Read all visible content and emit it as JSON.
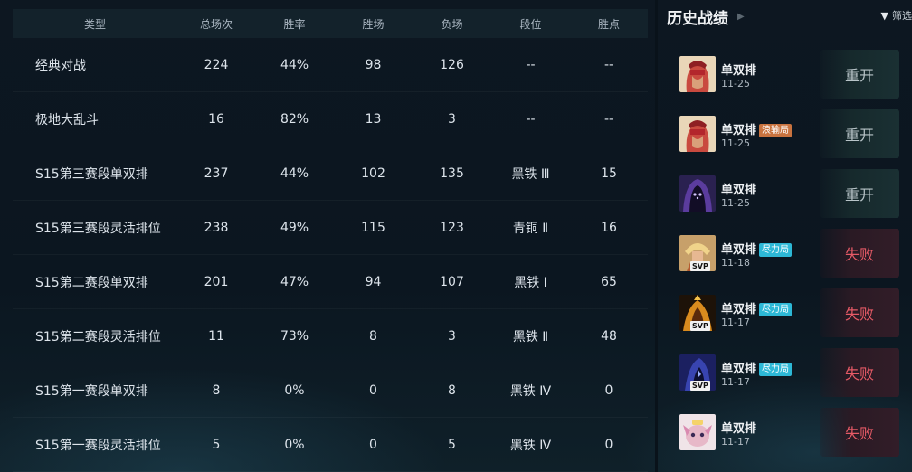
{
  "stats_table": {
    "headers": [
      "类型",
      "总场次",
      "胜率",
      "胜场",
      "负场",
      "段位",
      "胜点"
    ],
    "rows": [
      [
        "经典对战",
        "224",
        "44%",
        "98",
        "126",
        "--",
        "--"
      ],
      [
        "极地大乱斗",
        "16",
        "82%",
        "13",
        "3",
        "--",
        "--"
      ],
      [
        "S15第三赛段单双排",
        "237",
        "44%",
        "102",
        "135",
        "黑铁 Ⅲ",
        "15"
      ],
      [
        "S15第三赛段灵活排位",
        "238",
        "49%",
        "115",
        "123",
        "青铜 Ⅱ",
        "16"
      ],
      [
        "S15第二赛段单双排",
        "201",
        "47%",
        "94",
        "107",
        "黑铁 Ⅰ",
        "65"
      ],
      [
        "S15第二赛段灵活排位",
        "11",
        "73%",
        "8",
        "3",
        "黑铁 Ⅱ",
        "48"
      ],
      [
        "S15第一赛段单双排",
        "8",
        "0%",
        "0",
        "8",
        "黑铁 Ⅳ",
        "0"
      ],
      [
        "S15第一赛段灵活排位",
        "5",
        "0%",
        "0",
        "5",
        "黑铁 Ⅳ",
        "0"
      ]
    ]
  },
  "history": {
    "title": "历史战绩",
    "chevron_icon": "chevron-right-icon",
    "filter_label": "筛选",
    "filter_icon": "funnel-icon",
    "colors": {
      "remake": "#b8c4c8",
      "loss": "#e65a66",
      "tag_orange": "#c9733f",
      "tag_cyan": "#2db8d6"
    },
    "matches": [
      {
        "champion_icon": "champion-red-masked-icon",
        "mode": "单双排",
        "tag": "",
        "date": "11-25",
        "result": "重开",
        "svp": ""
      },
      {
        "champion_icon": "champion-red-masked-icon",
        "mode": "单双排",
        "tag": "浪输局",
        "tag_color": "orange",
        "date": "11-25",
        "result": "重开",
        "svp": ""
      },
      {
        "champion_icon": "champion-purple-hooded-icon",
        "mode": "单双排",
        "tag": "",
        "date": "11-25",
        "result": "重开",
        "svp": ""
      },
      {
        "champion_icon": "champion-golden-helm-icon",
        "mode": "单双排",
        "tag": "尽力局",
        "tag_color": "cyan",
        "date": "11-18",
        "result": "失败",
        "svp": "SVP"
      },
      {
        "champion_icon": "champion-flame-armor-icon",
        "mode": "单双排",
        "tag": "尽力局",
        "tag_color": "cyan",
        "date": "11-17",
        "result": "失败",
        "svp": "SVP"
      },
      {
        "champion_icon": "champion-dark-blue-icon",
        "mode": "单双排",
        "tag": "尽力局",
        "tag_color": "cyan",
        "date": "11-17",
        "result": "失败",
        "svp": "SVP"
      },
      {
        "champion_icon": "champion-yordle-pink-icon",
        "mode": "单双排",
        "tag": "",
        "date": "11-17",
        "result": "失败",
        "svp": ""
      }
    ]
  }
}
